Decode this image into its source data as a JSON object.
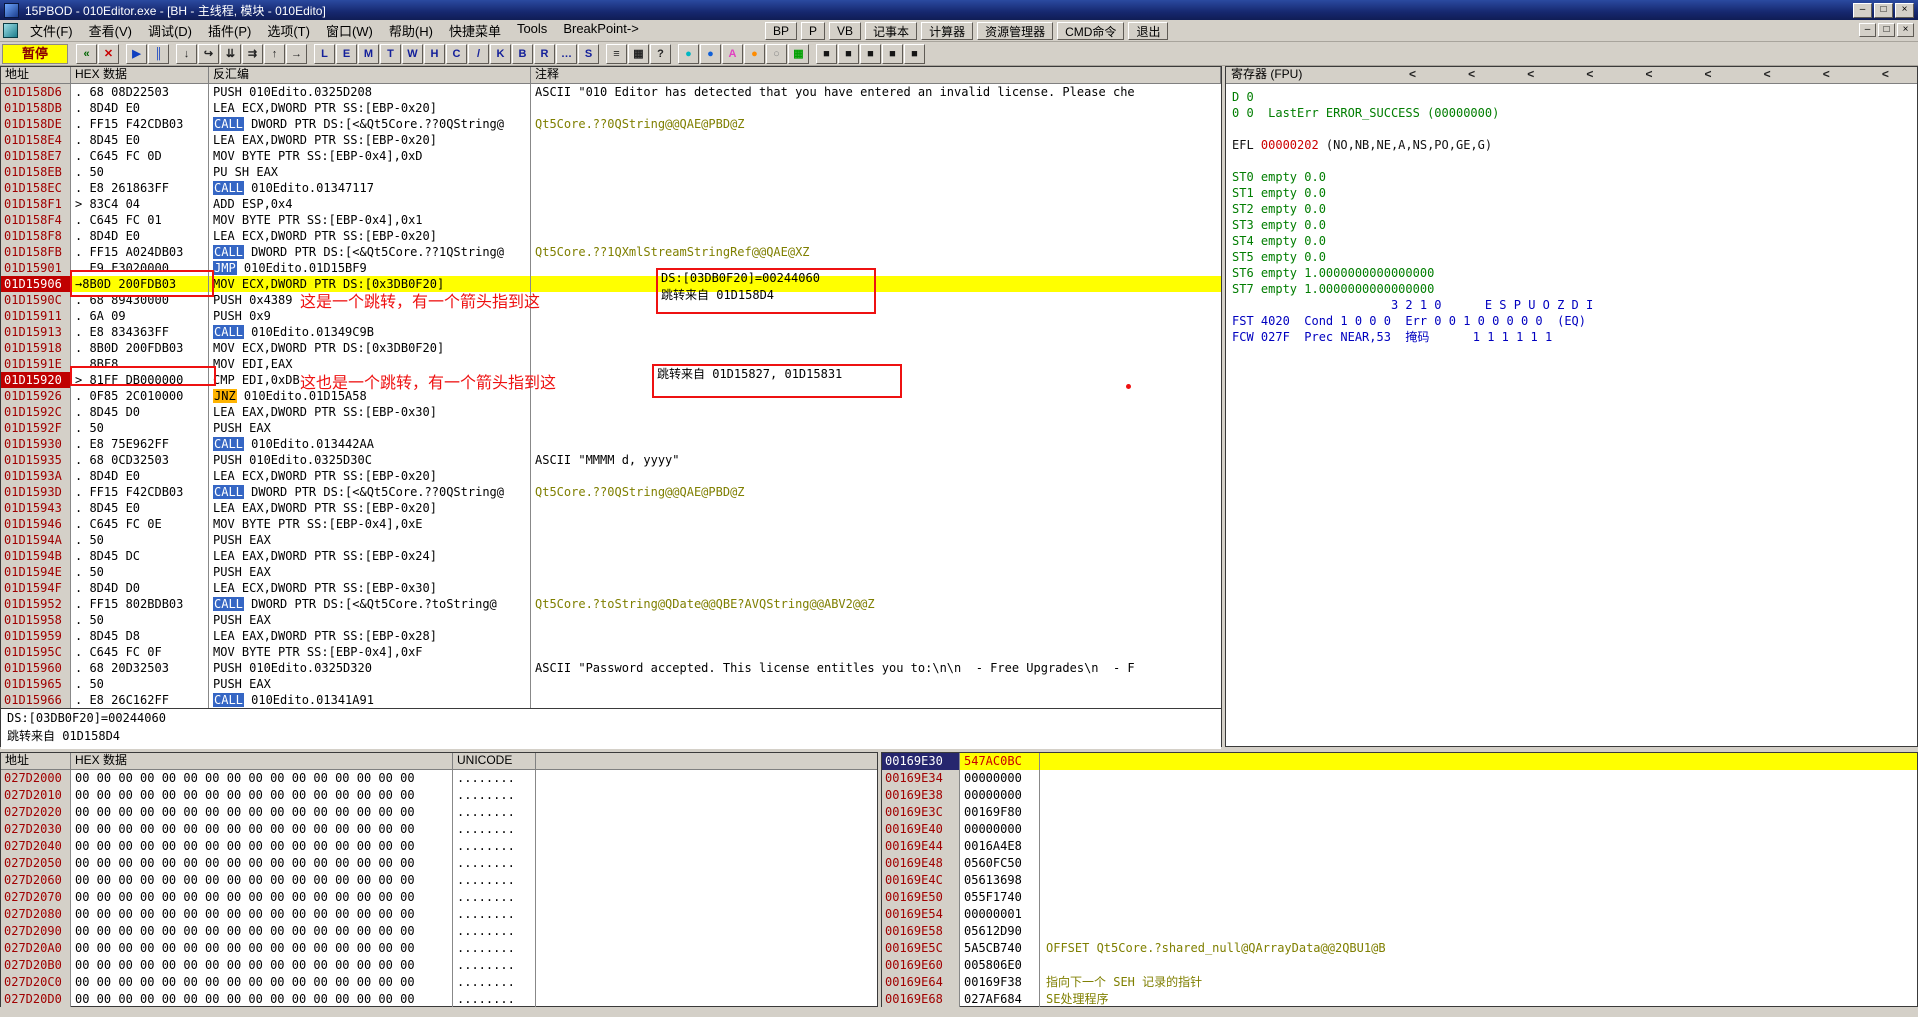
{
  "window": {
    "title": "15PBOD - 010Editor.exe - [BH - 主线程, 模块 - 010Edito]",
    "controls": [
      {
        "name": "minimize-button",
        "glyph": "–"
      },
      {
        "name": "maximize-button",
        "glyph": "□"
      },
      {
        "name": "close-button",
        "glyph": "×"
      }
    ]
  },
  "menu": {
    "items": [
      "文件(F)",
      "查看(V)",
      "调试(D)",
      "插件(P)",
      "选项(T)",
      "窗口(W)",
      "帮助(H)",
      "快捷菜单",
      "Tools",
      "BreakPoint->"
    ],
    "quick_buttons": [
      {
        "name": "bp-button",
        "label": "BP"
      },
      {
        "name": "p-button",
        "label": "P"
      },
      {
        "name": "vb-button",
        "label": "VB"
      },
      {
        "name": "notepad-button",
        "label": "记事本"
      },
      {
        "name": "calculator-button",
        "label": "计算器"
      },
      {
        "name": "explorer-button",
        "label": "资源管理器"
      },
      {
        "name": "cmd-button",
        "label": "CMD命令"
      },
      {
        "name": "exit-button",
        "label": "退出"
      }
    ],
    "child_controls": [
      {
        "name": "child-minimize-button",
        "glyph": "–"
      },
      {
        "name": "child-restore-button",
        "glyph": "□"
      },
      {
        "name": "child-close-button",
        "glyph": "×"
      }
    ]
  },
  "toolbar": {
    "pause_label": "暂停",
    "groups": [
      [
        {
          "name": "restart-icon",
          "glyph": "«",
          "color": "#006400"
        },
        {
          "name": "close-program-icon",
          "glyph": "✕",
          "color": "#c80000"
        }
      ],
      [
        {
          "name": "run-icon",
          "glyph": "▶",
          "color": "#1040c0"
        },
        {
          "name": "pause-icon",
          "glyph": "║",
          "color": "#1040c0"
        }
      ],
      [
        {
          "name": "step-into-icon",
          "glyph": "↓",
          "color": "#222222"
        },
        {
          "name": "step-over-icon",
          "glyph": "↪",
          "color": "#222222"
        },
        {
          "name": "animate-into-icon",
          "glyph": "⇊",
          "color": "#222222"
        },
        {
          "name": "animate-over-icon",
          "glyph": "⇉",
          "color": "#222222"
        },
        {
          "name": "until-return-icon",
          "glyph": "↑",
          "color": "#222222"
        },
        {
          "name": "goto-icon",
          "glyph": "→",
          "color": "#222222"
        }
      ],
      [
        {
          "name": "log-window-button",
          "glyph": "L",
          "color": "#14209a"
        },
        {
          "name": "modules-window-button",
          "glyph": "E",
          "color": "#14209a"
        },
        {
          "name": "memory-window-button",
          "glyph": "M",
          "color": "#14209a"
        },
        {
          "name": "threads-window-button",
          "glyph": "T",
          "color": "#14209a"
        },
        {
          "name": "windows-window-button",
          "glyph": "W",
          "color": "#14209a"
        },
        {
          "name": "handles-window-button",
          "glyph": "H",
          "color": "#14209a"
        },
        {
          "name": "cpu-window-button",
          "glyph": "C",
          "color": "#14209a"
        },
        {
          "name": "patches-window-button",
          "glyph": "/",
          "color": "#14209a"
        },
        {
          "name": "callstack-window-button",
          "glyph": "K",
          "color": "#14209a"
        },
        {
          "name": "breakpoints-window-button",
          "glyph": "B",
          "color": "#14209a"
        },
        {
          "name": "references-window-button",
          "glyph": "R",
          "color": "#14209a"
        },
        {
          "name": "runtrace-window-button",
          "glyph": "…",
          "color": "#14209a"
        },
        {
          "name": "source-window-button",
          "glyph": "S",
          "color": "#14209a"
        }
      ],
      [
        {
          "name": "log-icon",
          "glyph": "≡",
          "color": "#222222"
        },
        {
          "name": "memory-map-icon",
          "glyph": "▦",
          "color": "#222222"
        },
        {
          "name": "help-icon",
          "glyph": "?",
          "color": "#222222"
        }
      ],
      [
        {
          "name": "cyan-plugin-icon",
          "glyph": "●",
          "color": "#00b7c3"
        },
        {
          "name": "blue-plugin-icon",
          "glyph": "●",
          "color": "#1060d8"
        },
        {
          "name": "pink-plugin-icon",
          "glyph": "A",
          "color": "#e040c0"
        },
        {
          "name": "orange-plugin-icon",
          "glyph": "●",
          "color": "#ff8c00"
        },
        {
          "name": "white-plugin-icon",
          "glyph": "○",
          "color": "#888888"
        },
        {
          "name": "green-plugin-icon",
          "glyph": "▦",
          "color": "#00a000"
        }
      ],
      [
        {
          "name": "plugin-slot-1-icon",
          "glyph": "■",
          "color": "#151515"
        },
        {
          "name": "plugin-slot-2-icon",
          "glyph": "■",
          "color": "#151515"
        },
        {
          "name": "plugin-slot-3-icon",
          "glyph": "■",
          "color": "#151515"
        },
        {
          "name": "plugin-slot-4-icon",
          "glyph": "■",
          "color": "#151515"
        },
        {
          "name": "plugin-slot-5-icon",
          "glyph": "■",
          "color": "#151515"
        }
      ]
    ]
  },
  "disasm": {
    "headers": {
      "address": "地址",
      "hex": "HEX 数据",
      "disasm": "反汇编",
      "comment": "注释"
    },
    "rows": [
      {
        "a": "01D158D6",
        "x": ". 68 08D22503",
        "r": "PUSH 010Edito.0325D208",
        "c": "ASCII \"010 Editor has detected that you have entered an invalid license. Please che",
        "cc": "blk"
      },
      {
        "a": "01D158DB",
        "x": ". 8D4D E0",
        "r": "LEA ECX,DWORD PTR SS:[EBP-0x20]"
      },
      {
        "a": "01D158DE",
        "x": ". FF15 F42CDB03",
        "m": "CALL",
        "s": "call",
        "r": " DWORD PTR DS:[<&Qt5Core.??0QString@",
        "c": "Qt5Core.??0QString@@QAE@PBD@Z",
        "cc": "imp"
      },
      {
        "a": "01D158E4",
        "x": ". 8D45 E0",
        "r": "LEA EAX,DWORD PTR SS:[EBP-0x20]"
      },
      {
        "a": "01D158E7",
        "x": ". C645 FC 0D",
        "r": "MOV BYTE PTR SS:[EBP-0x4],0xD"
      },
      {
        "a": "01D158EB",
        "x": ". 50",
        "r": "PU SH EAX"
      },
      {
        "a": "01D158EC",
        "x": ". E8 261863FF",
        "m": "CALL",
        "s": "call",
        "r": " 010Edito.01347117"
      },
      {
        "a": "01D158F1",
        "x": "> 83C4 04",
        "r": "ADD ESP,0x4"
      },
      {
        "a": "01D158F4",
        "x": ". C645 FC 01",
        "r": "MOV BYTE PTR SS:[EBP-0x4],0x1"
      },
      {
        "a": "01D158F8",
        "x": ". 8D4D E0",
        "r": "LEA ECX,DWORD PTR SS:[EBP-0x20]"
      },
      {
        "a": "01D158FB",
        "x": ". FF15 A024DB03",
        "m": "CALL",
        "s": "call",
        "r": " DWORD PTR DS:[<&Qt5Core.??1QString@",
        "c": "Qt5Core.??1QXmlStreamStringRef@@QAE@XZ",
        "cc": "imp"
      },
      {
        "a": "01D15901",
        "x": ". E9 F3020000",
        "m": "JMP",
        "s": "jmp",
        "r": " 010Edito.01D15BF9"
      },
      {
        "a": "01D15906",
        "bp": true,
        "sel": true,
        "x": "→8B0D 200FDB03",
        "r": "MOV ECX,DWORD PTR DS:[0x3DB0F20]"
      },
      {
        "a": "01D1590C",
        "x": ". 68 89430000",
        "r": "PUSH 0x4389"
      },
      {
        "a": "01D15911",
        "x": ". 6A 09",
        "r": "PUSH 0x9"
      },
      {
        "a": "01D15913",
        "x": ". E8 834363FF",
        "m": "CALL",
        "s": "call",
        "r": " 010Edito.01349C9B"
      },
      {
        "a": "01D15918",
        "x": ". 8B0D 200FDB03",
        "r": "MOV ECX,DWORD PTR DS:[0x3DB0F20]"
      },
      {
        "a": "01D1591E",
        "x": ". 8BF8",
        "r": "MOV EDI,EAX"
      },
      {
        "a": "01D15920",
        "bp": true,
        "x": "> 81FF DB000000",
        "r": "CMP EDI,0xDB"
      },
      {
        "a": "01D15926",
        "x": ". 0F85 2C010000",
        "m": "JNZ",
        "s": "jnz",
        "r": " 010Edito.01D15A58"
      },
      {
        "a": "01D1592C",
        "x": ". 8D45 D0",
        "r": "LEA EAX,DWORD PTR SS:[EBP-0x30]"
      },
      {
        "a": "01D1592F",
        "x": ". 50",
        "r": "PUSH EAX"
      },
      {
        "a": "01D15930",
        "x": ". E8 75E962FF",
        "m": "CALL",
        "s": "call",
        "r": " 010Edito.013442AA"
      },
      {
        "a": "01D15935",
        "x": ". 68 0CD32503",
        "r": "PUSH 010Edito.0325D30C",
        "c": "ASCII \"MMMM d, yyyy\"",
        "cc": "blk"
      },
      {
        "a": "01D1593A",
        "x": ". 8D4D E0",
        "r": "LEA ECX,DWORD PTR SS:[EBP-0x20]"
      },
      {
        "a": "01D1593D",
        "x": ". FF15 F42CDB03",
        "m": "CALL",
        "s": "call",
        "r": " DWORD PTR DS:[<&Qt5Core.??0QString@",
        "c": "Qt5Core.??0QString@@QAE@PBD@Z",
        "cc": "imp"
      },
      {
        "a": "01D15943",
        "x": ". 8D45 E0",
        "r": "LEA EAX,DWORD PTR SS:[EBP-0x20]"
      },
      {
        "a": "01D15946",
        "x": ". C645 FC 0E",
        "r": "MOV BYTE PTR SS:[EBP-0x4],0xE"
      },
      {
        "a": "01D1594A",
        "x": ". 50",
        "r": "PUSH EAX"
      },
      {
        "a": "01D1594B",
        "x": ". 8D45 DC",
        "r": "LEA EAX,DWORD PTR SS:[EBP-0x24]"
      },
      {
        "a": "01D1594E",
        "x": ". 50",
        "r": "PUSH EAX"
      },
      {
        "a": "01D1594F",
        "x": ". 8D4D D0",
        "r": "LEA ECX,DWORD PTR SS:[EBP-0x30]"
      },
      {
        "a": "01D15952",
        "x": ". FF15 802BDB03",
        "m": "CALL",
        "s": "call",
        "r": " DWORD PTR DS:[<&Qt5Core.?toString@",
        "c": "Qt5Core.?toString@QDate@@QBE?AVQString@@ABV2@@Z",
        "cc": "imp"
      },
      {
        "a": "01D15958",
        "x": ". 50",
        "r": "PUSH EAX"
      },
      {
        "a": "01D15959",
        "x": ". 8D45 D8",
        "r": "LEA EAX,DWORD PTR SS:[EBP-0x28]"
      },
      {
        "a": "01D1595C",
        "x": ". C645 FC 0F",
        "r": "MOV BYTE PTR SS:[EBP-0x4],0xF"
      },
      {
        "a": "01D15960",
        "x": ". 68 20D32503",
        "r": "PUSH 010Edito.0325D320",
        "c": "ASCII \"Password accepted. This license entitles you to:\\n\\n  - Free Upgrades\\n  - F",
        "cc": "blk"
      },
      {
        "a": "01D15965",
        "x": ". 50",
        "r": "PUSH EAX"
      },
      {
        "a": "01D15966",
        "x": ". E8 26C162FF",
        "m": "CALL",
        "s": "call",
        "r": " 010Edito.01341A91"
      }
    ],
    "info_lines": [
      "DS:[03DB0F20]=00244060",
      "跳转来自 01D158D4"
    ]
  },
  "registers": {
    "header": "寄存器 (FPU)",
    "chevron_glyph": "<",
    "chevron_count": 9,
    "lines": [
      [
        {
          "t": "D 0",
          "c": "grn"
        }
      ],
      [
        {
          "t": "0 0  LastErr ERROR_SUCCESS (00000000)",
          "c": "grn"
        }
      ],
      [],
      [
        {
          "t": "EFL ",
          "c": "blk"
        },
        {
          "t": "00000202",
          "c": "red"
        },
        {
          "t": " (NO,NB,NE,A,NS,PO,GE,G)",
          "c": "blk"
        }
      ],
      [],
      [
        {
          "t": "ST0 empty 0.0",
          "c": "grn"
        }
      ],
      [
        {
          "t": "ST1 empty 0.0",
          "c": "grn"
        }
      ],
      [
        {
          "t": "ST2 empty 0.0",
          "c": "grn"
        }
      ],
      [
        {
          "t": "ST3 empty 0.0",
          "c": "grn"
        }
      ],
      [
        {
          "t": "ST4 empty 0.0",
          "c": "grn"
        }
      ],
      [
        {
          "t": "ST5 empty 0.0",
          "c": "grn"
        }
      ],
      [
        {
          "t": "ST6 empty 1.0000000000000000",
          "c": "grn"
        }
      ],
      [
        {
          "t": "ST7 empty 1.0000000000000000",
          "c": "grn"
        }
      ],
      [
        {
          "t": "                      3 2 1 0      E S P U O Z D I",
          "c": "blu"
        }
      ],
      [
        {
          "t": "FST 4020  Cond 1 0 0 0  Err 0 0 1 0 0 0 0 0  (EQ)",
          "c": "blu"
        }
      ],
      [
        {
          "t": "FCW 027F  Prec NEAR,53  掩码      1 1 1 1 1 1",
          "c": "blu"
        }
      ]
    ]
  },
  "dump": {
    "headers": {
      "address": "地址",
      "hex": "HEX 数据",
      "unicode": "UNICODE"
    },
    "hex_fill": "00 00 00 00 00 00 00 00 00 00 00 00 00 00 00 00",
    "unicode_fill": "........",
    "rows": [
      {
        "a": "027D2000"
      },
      {
        "a": "027D2010"
      },
      {
        "a": "027D2020"
      },
      {
        "a": "027D2030"
      },
      {
        "a": "027D2040"
      },
      {
        "a": "027D2050"
      },
      {
        "a": "027D2060"
      },
      {
        "a": "027D2070"
      },
      {
        "a": "027D2080"
      },
      {
        "a": "027D2090"
      },
      {
        "a": "027D20A0"
      },
      {
        "a": "027D20B0"
      },
      {
        "a": "027D20C0"
      },
      {
        "a": "027D20D0"
      }
    ]
  },
  "stack": {
    "rows": [
      {
        "a": "00169E30",
        "v": "547AC0BC",
        "sel": true,
        "red": true
      },
      {
        "a": "00169E34",
        "v": "00000000"
      },
      {
        "a": "00169E38",
        "v": "00000000"
      },
      {
        "a": "00169E3C",
        "v": "00169F80"
      },
      {
        "a": "00169E40",
        "v": "00000000"
      },
      {
        "a": "00169E44",
        "v": "0016A4E8"
      },
      {
        "a": "00169E48",
        "v": "0560FC50"
      },
      {
        "a": "00169E4C",
        "v": "05613698"
      },
      {
        "a": "00169E50",
        "v": "055F1740"
      },
      {
        "a": "00169E54",
        "v": "00000001"
      },
      {
        "a": "00169E58",
        "v": "05612D90"
      },
      {
        "a": "00169E5C",
        "v": "5A5CB740",
        "c": "OFFSET Qt5Core.?shared_null@QArrayData@@2QBU1@B"
      },
      {
        "a": "00169E60",
        "v": "005806E0"
      },
      {
        "a": "00169E64",
        "v": "00169F38",
        "c": "指向下一个 SEH 记录的指针"
      },
      {
        "a": "00169E68",
        "v": "027AF684",
        "c": "SE处理程序"
      }
    ]
  },
  "annotations": {
    "jump1_text": "这是一个跳转，有一个箭头指到这",
    "jump2_text": "这也是一个跳转，有一个箭头指到这",
    "box_ds": "DS:[03DB0F20]=00244060",
    "box_from1": "跳转来自 01D158D4",
    "box_from2": "跳转来自 01D15827, 01D15831"
  },
  "colors": {
    "selection_yellow": "#ffff00",
    "address_red": "#a00000",
    "breakpoint_red": "#c00000",
    "call_blue": "#3566c4",
    "jnz_orange": "#ffb400",
    "comment_olive": "#7f7f00",
    "register_green": "#007d00",
    "register_blue": "#0000bf",
    "annotation_red": "#ee1111"
  }
}
